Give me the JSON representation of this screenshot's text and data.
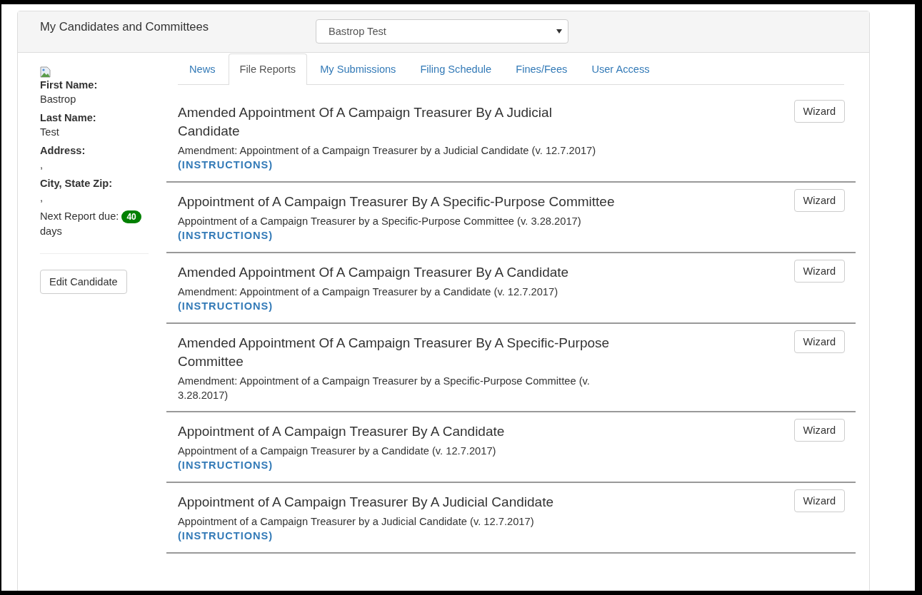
{
  "header": {
    "title": "My Candidates and Committees",
    "select": {
      "value": "Bastrop Test"
    }
  },
  "profile": {
    "fields": [
      {
        "label": "First Name:",
        "value": "Bastrop"
      },
      {
        "label": "Last Name:",
        "value": "Test"
      },
      {
        "label": "Address:",
        "value": ","
      },
      {
        "label": "City, State Zip:",
        "value": ","
      }
    ],
    "next_report": {
      "label": "Next Report due:",
      "badge": "40",
      "suffix": "days"
    },
    "edit_button": "Edit Candidate"
  },
  "tabs": [
    {
      "label": "News",
      "selected": false
    },
    {
      "label": "File Reports",
      "selected": true
    },
    {
      "label": "My Submissions",
      "selected": false
    },
    {
      "label": "Filing Schedule",
      "selected": false
    },
    {
      "label": "Fines/Fees",
      "selected": false
    },
    {
      "label": "User Access",
      "selected": false
    }
  ],
  "reports": [
    {
      "title": "Amended Appointment Of A Campaign Treasurer By A Judicial Candidate",
      "description": "Amendment: Appointment of a Campaign Treasurer by a Judicial Candidate (v. 12.7.2017)",
      "instructions": "(INSTRUCTIONS)",
      "button": "Wizard"
    },
    {
      "title": "Appointment of A Campaign Treasurer By A Specific-Purpose Committee",
      "description": "Appointment of a Campaign Treasurer by a Specific-Purpose Committee (v. 3.28.2017)",
      "instructions": "(INSTRUCTIONS)",
      "button": "Wizard"
    },
    {
      "title": "Amended Appointment Of A Campaign Treasurer By A Candidate",
      "description": "Amendment: Appointment of a Campaign Treasurer by a Candidate (v. 12.7.2017)",
      "instructions": "(INSTRUCTIONS)",
      "button": "Wizard"
    },
    {
      "title": "Amended Appointment Of A Campaign Treasurer By A Specific-Purpose Committee",
      "description": "Amendment: Appointment of a Campaign Treasurer by a Specific-Purpose Committee (v. 3.28.2017)",
      "button": "Wizard"
    },
    {
      "title": "Appointment of A Campaign Treasurer By A Candidate",
      "description": "Appointment of a Campaign Treasurer by a Candidate (v. 12.7.2017)",
      "instructions": "(INSTRUCTIONS)",
      "button": "Wizard"
    },
    {
      "title": "Appointment of A Campaign Treasurer By A Judicial Candidate",
      "description": "Appointment of a Campaign Treasurer by a Judicial Candidate (v. 12.7.2017)",
      "instructions": "(INSTRUCTIONS)",
      "button": "Wizard"
    }
  ]
}
